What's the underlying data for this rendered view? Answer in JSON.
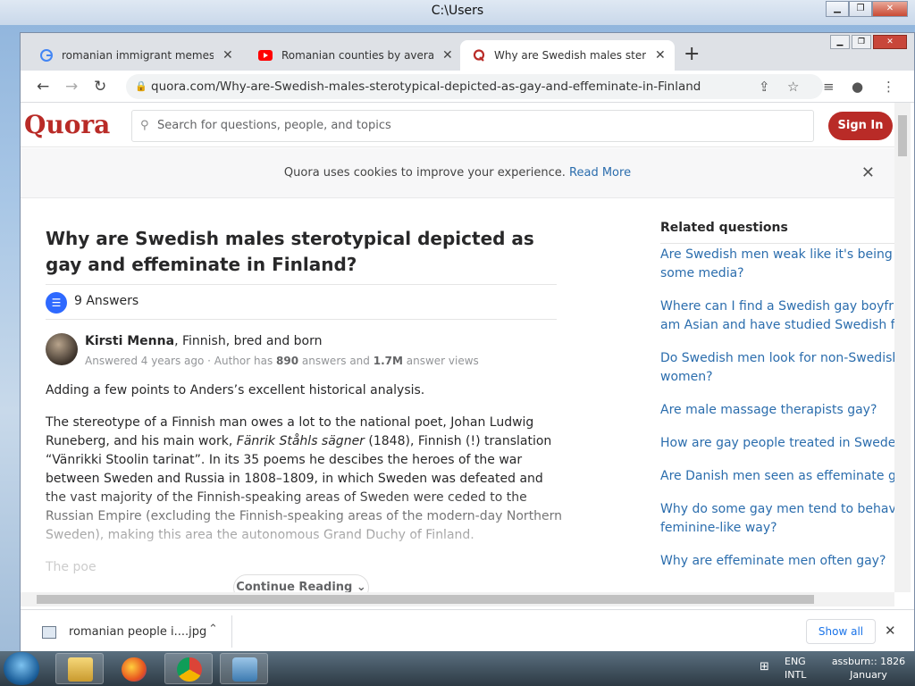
{
  "desktop": {
    "title": "C:\\Users"
  },
  "browser": {
    "tabs": [
      {
        "label": "romanian immigrant memes - Go",
        "close": "✕",
        "favicon": "google-icon",
        "active": false
      },
      {
        "label": "Romanian counties by average ne",
        "close": "✕",
        "favicon": "youtube-icon",
        "active": false
      },
      {
        "label": "Why are Swedish males sterotypic",
        "close": "✕",
        "favicon": "quora-icon",
        "active": true
      }
    ],
    "new_tab": "+",
    "url": "quora.com/Why-are-Swedish-males-sterotypical-depicted-as-gay-and-effeminate-in-Finland"
  },
  "quora": {
    "logo": "Quora",
    "search_placeholder": "Search for questions, people, and topics",
    "sign_in": "Sign In",
    "cookie_text": "Quora uses cookies to improve your experience.",
    "cookie_link": "Read More",
    "question": "Why are Swedish males sterotypical depicted as gay and effeminate in Finland?",
    "answers_count": "9 Answers",
    "author_name": "Kirsti Menna",
    "author_cred": ", Finnish, bred and born",
    "meta_prefix": "Answered 4 years ago · Author has ",
    "meta_answers": "890",
    "meta_mid": " answers and ",
    "meta_views": "1.7M",
    "meta_suffix": " answer views",
    "answer_p1": "Adding a few points to Anders’s excellent historical analysis.",
    "answer_p2_a": "The stereotype of a Finnish man owes a lot to the national poet, Johan Ludwig Runeberg, and his main work, ",
    "answer_p2_italic": "Fänrik Ståhls sägner",
    "answer_p2_b": " (1848), Finnish (!) translation “Vänrikki Stoolin tarinat”. In its 35 poems he descibes the heroes of the war between Sweden and Russia in 1808–1809, in which Sweden was defeated and the vast majority of the Finnish-speaking areas of Sweden were ceded to the Russian Empire (excluding the Finnish-speaking areas of the modern-day Northern Sweden), making this area the autonomous Grand Duchy of Finland.",
    "answer_p3": "The poe",
    "continue_reading": "Continue Reading",
    "related_title": "Related questions",
    "related": [
      "Are Swedish men weak like it's being sa",
      "some media?",
      "Where can I find a Swedish gay boyfrie",
      "am Asian and have studied Swedish for",
      "Do Swedish men look for non-Swedish",
      "women?",
      "Are male massage therapists gay?",
      "How are gay people treated in Sweden?",
      "Are Danish men seen as effeminate glo",
      "Why do some gay men tend to behave",
      "feminine-like way?",
      "Why are effeminate men often gay?"
    ]
  },
  "downloads": {
    "file": "romanian people i....jpg",
    "show_all": "Show all"
  },
  "taskbar": {
    "lang_1": "ENG",
    "lang_2": "INTL",
    "clock_1": "assburn:: 1826",
    "clock_2": "January"
  },
  "colors": {
    "quora_red": "#b92b27",
    "link_blue": "#2b6dad",
    "answers_blue": "#2e69ff"
  }
}
